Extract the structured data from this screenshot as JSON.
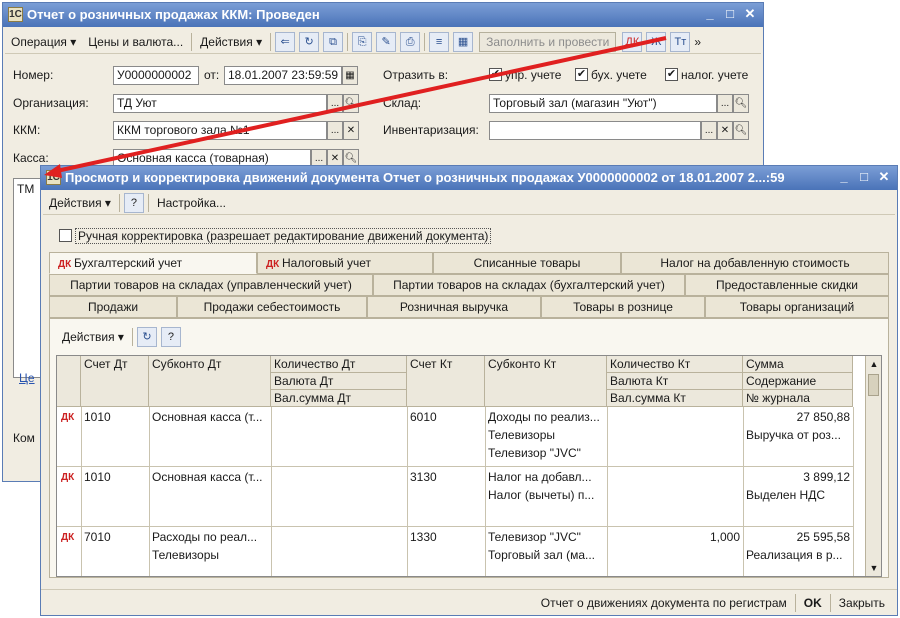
{
  "back_window": {
    "title": "Отчет о розничных продажах ККМ: Проведен",
    "toolbar": {
      "operation": "Операция ▾",
      "prices": "Цены и валюта...",
      "actions": "Действия ▾",
      "fill_post": "Заполнить и провести"
    },
    "form": {
      "number_label": "Номер:",
      "number_value": "У0000000002",
      "from_label": "от:",
      "date_value": "18.01.2007 23:59:59",
      "reflect_label": "Отразить в:",
      "mgmt_label": "упр. учете",
      "acc_label": "бух. учете",
      "tax_label": "налог. учете",
      "org_label": "Организация:",
      "org_value": "ТД Уют",
      "warehouse_label": "Склад:",
      "warehouse_value": "Торговый зал (магазин \"Уют\")",
      "kkm_label": "ККМ:",
      "kkm_value": "ККМ торгового зала №1",
      "inventory_label": "Инвентаризация:",
      "cash_label": "Касса:",
      "cash_value": "Основная касса (товарная)",
      "left_frag_1": "ТМ",
      "left_frag_2": "Це",
      "left_frag_3": "Ком"
    }
  },
  "front_window": {
    "title": "Просмотр и корректировка движений документа Отчет о розничных продажах У0000000002 от 18.01.2007 2...:59",
    "toolbar": {
      "actions": "Действия ▾",
      "help": "?",
      "settings": "Настройка..."
    },
    "manual_edit": "Ручная корректировка (разрешает редактирование движений документа)",
    "tabs_row1": [
      "Бухгалтерский учет",
      "Налоговый учет",
      "Списанные товары",
      "Налог на добавленную стоимость"
    ],
    "tabs_row2": [
      "Партии товаров на складах (управленческий учет)",
      "Партии товаров на складах (бухгалтерский учет)",
      "Предоставленные скидки"
    ],
    "tabs_row3": [
      "Продажи",
      "Продажи себестоимость",
      "Розничная выручка",
      "Товары в рознице",
      "Товары организаций"
    ],
    "inner_toolbar": {
      "actions": "Действия ▾",
      "help": "?"
    },
    "grid": {
      "headers": {
        "debit_acc": "Счет Дт",
        "debit_sub": "Субконто Дт",
        "debit_qty": "Количество Дт",
        "debit_cur": "Валюта Дт",
        "debit_cur_sum": "Вал.сумма Дт",
        "credit_acc": "Счет Кт",
        "credit_sub": "Субконто Кт",
        "credit_qty": "Количество Кт",
        "credit_cur": "Валюта Кт",
        "credit_cur_sum": "Вал.сумма Кт",
        "sum": "Сумма",
        "content": "Содержание",
        "journal": "№ журнала"
      },
      "rows": [
        {
          "debit_acc": "1010",
          "debit_sub": [
            "Основная касса (т...",
            ""
          ],
          "credit_acc": "6010",
          "credit_sub": [
            "Доходы по реализ...",
            "Телевизоры",
            "Телевизор \"JVC\""
          ],
          "credit_qty": "",
          "sum": "27 850,88",
          "content": "Выручка от роз..."
        },
        {
          "debit_acc": "1010",
          "debit_sub": [
            "Основная касса (т...",
            ""
          ],
          "credit_acc": "3130",
          "credit_sub": [
            "Налог на добавл...",
            "Налог (вычеты) п...",
            ""
          ],
          "credit_qty": "",
          "sum": "3 899,12",
          "content": "Выделен НДС"
        },
        {
          "debit_acc": "7010",
          "debit_sub": [
            "Расходы по реал...",
            "Телевизоры"
          ],
          "credit_acc": "1330",
          "credit_sub": [
            "Телевизор \"JVC\"",
            "Торговый зал (ма...",
            ""
          ],
          "credit_qty": "1,000",
          "sum": "25 595,58",
          "content": "Реализация в р..."
        }
      ]
    },
    "statusbar": {
      "report": "Отчет о движениях документа по регистрам",
      "ok": "OK",
      "close": "Закрыть"
    }
  },
  "colors": {
    "titlebar": "#4a73b8",
    "arrow": "#e02020",
    "window_bg": "#f1ede2"
  }
}
